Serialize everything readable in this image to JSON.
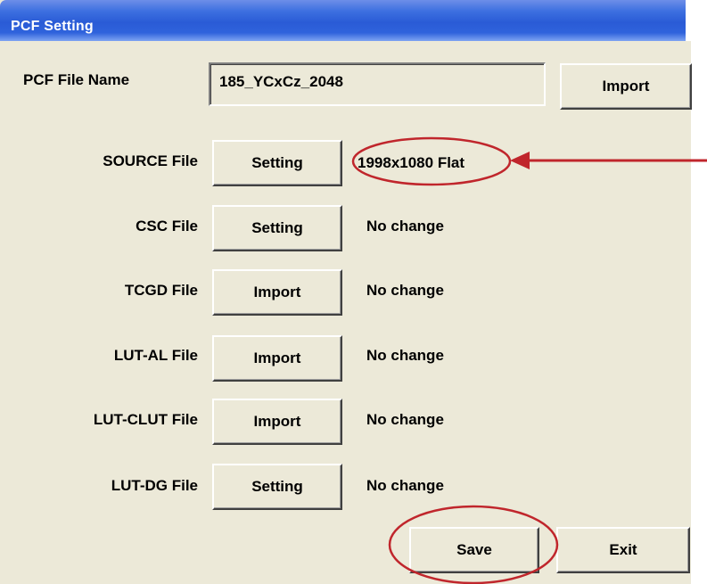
{
  "window": {
    "title": "PCF Setting"
  },
  "pcf": {
    "label": "PCF File Name",
    "value": "185_YCxCz_2048",
    "import_label": "Import"
  },
  "rows": [
    {
      "label": "SOURCE File",
      "button": "Setting",
      "status": "1998x1080 Flat"
    },
    {
      "label": "CSC File",
      "button": "Setting",
      "status": "No change"
    },
    {
      "label": "TCGD File",
      "button": "Import",
      "status": "No change"
    },
    {
      "label": "LUT-AL File",
      "button": "Import",
      "status": "No change"
    },
    {
      "label": "LUT-CLUT File",
      "button": "Import",
      "status": "No change"
    },
    {
      "label": "LUT-DG File",
      "button": "Setting",
      "status": "No change"
    }
  ],
  "footer": {
    "save_label": "Save",
    "exit_label": "Exit"
  },
  "annotations": {
    "color": "#c0262c"
  }
}
